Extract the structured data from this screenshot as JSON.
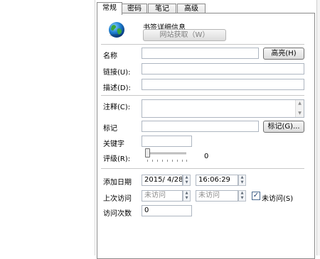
{
  "tabs": [
    {
      "label": "常规"
    },
    {
      "label": "密码"
    },
    {
      "label": "笔记"
    },
    {
      "label": "高级"
    }
  ],
  "header": {
    "title": "书签详细信息",
    "fetch_button": "网站获取（W）",
    "icon": "globe-icon"
  },
  "fields": {
    "name_label": "名称",
    "name_value": "",
    "highlight_button": "高亮(H)",
    "link_label": "链接(U):",
    "link_value": "",
    "desc_label": "描述(D):",
    "desc_value": "",
    "note_label": "注释(C):",
    "note_value": "",
    "tag_label": "标记",
    "tag_value": "",
    "tag_button": "标记(G)...",
    "keyword_label": "关键字",
    "keyword_value": "",
    "rating_label": "评级(R):",
    "rating_value": "0"
  },
  "dates": {
    "added_label": "添加日期",
    "added_date": "2015/ 4/28",
    "added_time": "16:06:29",
    "last_visit_label": "上次访问",
    "last_visit_date": "未访问",
    "last_visit_time": "未访问",
    "not_visited_checkbox": "未访问(S)",
    "not_visited_checked": true,
    "visit_count_label": "访问次数",
    "visit_count_value": "0"
  }
}
